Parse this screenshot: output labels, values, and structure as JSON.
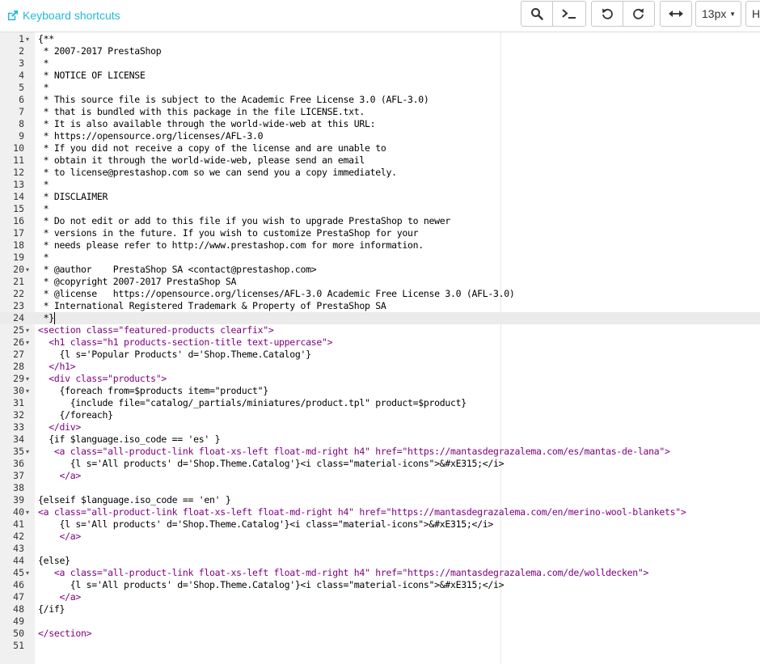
{
  "header": {
    "shortcuts_label": "Keyboard shortcuts",
    "font_size_value": "13px",
    "cut_label": "H"
  },
  "editor": {
    "active_line": 24,
    "fold_lines": [
      1,
      20,
      25,
      26,
      29,
      30,
      35,
      40,
      45
    ],
    "lines": [
      {
        "n": "1",
        "text": "{**",
        "kind": "normal"
      },
      {
        "n": "2",
        "text": " * 2007-2017 PrestaShop",
        "kind": "normal"
      },
      {
        "n": "3",
        "text": " *",
        "kind": "normal"
      },
      {
        "n": "4",
        "text": " * NOTICE OF LICENSE",
        "kind": "normal"
      },
      {
        "n": "5",
        "text": " *",
        "kind": "normal"
      },
      {
        "n": "6",
        "text": " * This source file is subject to the Academic Free License 3.0 (AFL-3.0)",
        "kind": "normal"
      },
      {
        "n": "7",
        "text": " * that is bundled with this package in the file LICENSE.txt.",
        "kind": "normal"
      },
      {
        "n": "8",
        "text": " * It is also available through the world-wide-web at this URL:",
        "kind": "normal"
      },
      {
        "n": "9",
        "text": " * https://opensource.org/licenses/AFL-3.0",
        "kind": "normal"
      },
      {
        "n": "10",
        "text": " * If you did not receive a copy of the license and are unable to",
        "kind": "normal"
      },
      {
        "n": "11",
        "text": " * obtain it through the world-wide-web, please send an email",
        "kind": "normal"
      },
      {
        "n": "12",
        "text": " * to license@prestashop.com so we can send you a copy immediately.",
        "kind": "normal"
      },
      {
        "n": "13",
        "text": " *",
        "kind": "normal"
      },
      {
        "n": "14",
        "text": " * DISCLAIMER",
        "kind": "normal"
      },
      {
        "n": "15",
        "text": " *",
        "kind": "normal"
      },
      {
        "n": "16",
        "text": " * Do not edit or add to this file if you wish to upgrade PrestaShop to newer",
        "kind": "normal"
      },
      {
        "n": "17",
        "text": " * versions in the future. If you wish to customize PrestaShop for your",
        "kind": "normal"
      },
      {
        "n": "18",
        "text": " * needs please refer to http://www.prestashop.com for more information.",
        "kind": "normal"
      },
      {
        "n": "19",
        "text": " *",
        "kind": "normal"
      },
      {
        "n": "20",
        "text": " * @author    PrestaShop SA <contact@prestashop.com>",
        "kind": "normal"
      },
      {
        "n": "21",
        "text": " * @copyright 2007-2017 PrestaShop SA",
        "kind": "normal"
      },
      {
        "n": "22",
        "text": " * @license   https://opensource.org/licenses/AFL-3.0 Academic Free License 3.0 (AFL-3.0)",
        "kind": "normal"
      },
      {
        "n": "23",
        "text": " * International Registered Trademark & Property of PrestaShop SA",
        "kind": "normal"
      },
      {
        "n": "24",
        "text": " *}",
        "kind": "normal"
      },
      {
        "n": "25",
        "text": "<section class=\"featured-products clearfix\">",
        "kind": "tag"
      },
      {
        "n": "26",
        "text": "  <h1 class=\"h1 products-section-title text-uppercase\">",
        "kind": "tag"
      },
      {
        "n": "27",
        "text": "    {l s='Popular Products' d='Shop.Theme.Catalog'}",
        "kind": "normal"
      },
      {
        "n": "28",
        "text": "  </h1>",
        "kind": "tag"
      },
      {
        "n": "29",
        "text": "  <div class=\"products\">",
        "kind": "tag"
      },
      {
        "n": "30",
        "text": "    {foreach from=$products item=\"product\"}",
        "kind": "normal"
      },
      {
        "n": "31",
        "text": "      {include file=\"catalog/_partials/miniatures/product.tpl\" product=$product}",
        "kind": "normal"
      },
      {
        "n": "32",
        "text": "    {/foreach}",
        "kind": "normal"
      },
      {
        "n": "33",
        "text": "  </div>",
        "kind": "tag"
      },
      {
        "n": "34",
        "text": "  {if $language.iso_code == 'es' }",
        "kind": "normal"
      },
      {
        "n": "35",
        "text": "   <a class=\"all-product-link float-xs-left float-md-right h4\" href=\"https://mantasdegrazalema.com/es/mantas-de-lana\">",
        "kind": "tag"
      },
      {
        "n": "36",
        "text": "      {l s='All products' d='Shop.Theme.Catalog'}<i class=\"material-icons\">&#xE315;</i>",
        "kind": "normal"
      },
      {
        "n": "37",
        "text": "    </a>",
        "kind": "tag"
      },
      {
        "n": "38",
        "text": "",
        "kind": "normal"
      },
      {
        "n": "39",
        "text": "{elseif $language.iso_code == 'en' }",
        "kind": "normal"
      },
      {
        "n": "40",
        "text": "<a class=\"all-product-link float-xs-left float-md-right h4\" href=\"https://mantasdegrazalema.com/en/merino-wool-blankets\">",
        "kind": "tag"
      },
      {
        "n": "41",
        "text": "    {l s='All products' d='Shop.Theme.Catalog'}<i class=\"material-icons\">&#xE315;</i>",
        "kind": "normal"
      },
      {
        "n": "42",
        "text": "    </a>",
        "kind": "tag"
      },
      {
        "n": "43",
        "text": "",
        "kind": "normal"
      },
      {
        "n": "44",
        "text": "{else}",
        "kind": "normal"
      },
      {
        "n": "45",
        "text": "   <a class=\"all-product-link float-xs-left float-md-right h4\" href=\"https://mantasdegrazalema.com/de/wolldecken\">",
        "kind": "tag"
      },
      {
        "n": "46",
        "text": "      {l s='All products' d='Shop.Theme.Catalog'}<i class=\"material-icons\">&#xE315;</i>",
        "kind": "normal"
      },
      {
        "n": "47",
        "text": "    </a>",
        "kind": "tag"
      },
      {
        "n": "48",
        "text": "{/if}",
        "kind": "normal"
      },
      {
        "n": "49",
        "text": "",
        "kind": "normal"
      },
      {
        "n": "50",
        "text": "</section>",
        "kind": "tag"
      },
      {
        "n": "51",
        "text": "",
        "kind": "normal"
      }
    ]
  }
}
